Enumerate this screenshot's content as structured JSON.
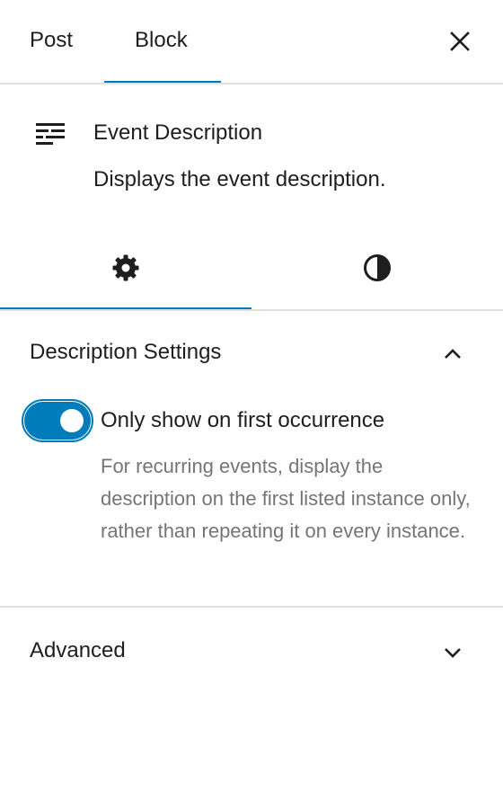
{
  "header": {
    "tabs": [
      {
        "label": "Post",
        "active": false
      },
      {
        "label": "Block",
        "active": true
      }
    ],
    "close_icon": "close-icon"
  },
  "block": {
    "icon": "text-lines-icon",
    "title": "Event Description",
    "description": "Displays the event description."
  },
  "inspector_tabs": [
    {
      "icon": "gear-icon",
      "active": true
    },
    {
      "icon": "half-circle-styles-icon",
      "active": false
    }
  ],
  "description_settings": {
    "title": "Description Settings",
    "expanded": true,
    "toggle": {
      "label": "Only show on first occurrence",
      "checked": true,
      "help": "For recurring events, display the description on the first listed instance only, rather than repeating it on every instance."
    }
  },
  "advanced": {
    "title": "Advanced",
    "expanded": false
  },
  "colors": {
    "accent": "#007cba",
    "text": "#1e1e1e",
    "muted": "#757575",
    "divider": "#e0e0e0"
  }
}
